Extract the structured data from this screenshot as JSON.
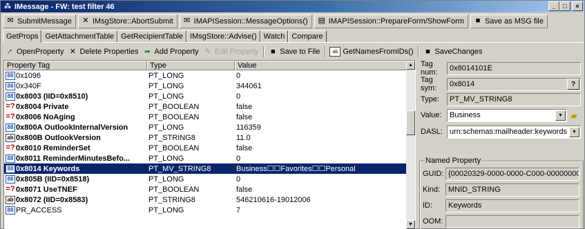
{
  "window": {
    "title": "IMessage - FW: test filter 46"
  },
  "toolbar1": [
    {
      "label": "SubmitMessage"
    },
    {
      "label": "IMsgStore::AbortSubmit"
    },
    {
      "label": "IMAPISession::MessageOptions()"
    },
    {
      "label": "IMAPISession::PrepareForm/ShowForm"
    },
    {
      "label": "Save as MSG file"
    }
  ],
  "tabs": [
    {
      "label": "GetProps"
    },
    {
      "label": "GetAttachmentTable"
    },
    {
      "label": "GetRecipientTable"
    },
    {
      "label": "IMsgStore::Advise()"
    },
    {
      "label": "Watch"
    },
    {
      "label": "Compare"
    }
  ],
  "toolbar2": [
    {
      "label": "OpenProperty"
    },
    {
      "label": "Delete Properties"
    },
    {
      "label": "Add Property"
    },
    {
      "label": "Edit Property"
    },
    {
      "label": "Save to File"
    },
    {
      "label": "GetNamesFromIDs()"
    },
    {
      "label": "SaveChanges"
    }
  ],
  "table": {
    "headers": [
      "Property Tag",
      "Type",
      "Value"
    ],
    "rows": [
      {
        "tag": "0x1096",
        "type": "PT_LONG",
        "value": "0",
        "icon": "grid",
        "bold": false
      },
      {
        "tag": "0x340F",
        "type": "PT_LONG",
        "value": "344061",
        "icon": "grid",
        "bold": false
      },
      {
        "tag": "0x8003 (IID=0x8510)",
        "type": "PT_LONG",
        "value": "0",
        "icon": "grid",
        "bold": true
      },
      {
        "tag": "0x8004 Private",
        "type": "PT_BOOLEAN",
        "value": "false",
        "icon": "bool",
        "bold": true
      },
      {
        "tag": "0x8006 NoAging",
        "type": "PT_BOOLEAN",
        "value": "false",
        "icon": "bool",
        "bold": true
      },
      {
        "tag": "0x800A OutlookInternalVersion",
        "type": "PT_LONG",
        "value": "116359",
        "icon": "grid",
        "bold": true
      },
      {
        "tag": "0x800B OutlookVersion",
        "type": "PT_STRING8",
        "value": "11.0",
        "icon": "text",
        "bold": true
      },
      {
        "tag": "0x8010 ReminderSet",
        "type": "PT_BOOLEAN",
        "value": "false",
        "icon": "bool",
        "bold": true
      },
      {
        "tag": "0x8011 ReminderMinutesBefo...",
        "type": "PT_LONG",
        "value": "0",
        "icon": "grid",
        "bold": true
      },
      {
        "tag": "0x8014 Keywords",
        "type": "PT_MV_STRING8",
        "value": "Business☐☐Favorites☐☐Personal",
        "icon": "grid",
        "bold": true,
        "selected": true
      },
      {
        "tag": "0x805B (IID=0x8518)",
        "type": "PT_LONG",
        "value": "0",
        "icon": "grid",
        "bold": true
      },
      {
        "tag": "0x8071 UseTNEF",
        "type": "PT_BOOLEAN",
        "value": "false",
        "icon": "bool",
        "bold": true
      },
      {
        "tag": "0x8072 (IID=0x8583)",
        "type": "PT_STRING8",
        "value": "546210616-19012006",
        "icon": "text",
        "bold": true
      },
      {
        "tag": "PR_ACCESS",
        "type": "PT_LONG",
        "value": "7",
        "icon": "grid",
        "bold": false
      }
    ]
  },
  "details": {
    "tag_num_label": "Tag num:",
    "tag_num": "0x8014101E",
    "tag_sym_label": "Tag sym:",
    "tag_sym": "0x8014",
    "type_label": "Type:",
    "type": "PT_MV_STRING8",
    "value_label": "Value:",
    "value": "Business",
    "dasl_label": "DASL:",
    "dasl": "urn:schemas:mailheader:keywords",
    "named_title": "Named Property",
    "guid_label": "GUID:",
    "guid": "{00020329-0000-0000-C000-00000000",
    "kind_label": "Kind:",
    "kind": "MNID_STRING",
    "id_label": "ID:",
    "id": "Keywords",
    "oom_label": "OOM:",
    "oom": ""
  },
  "colors": {
    "selection": "#0a246a",
    "face": "#d4d0c8",
    "titlebar": "#0a246a"
  }
}
